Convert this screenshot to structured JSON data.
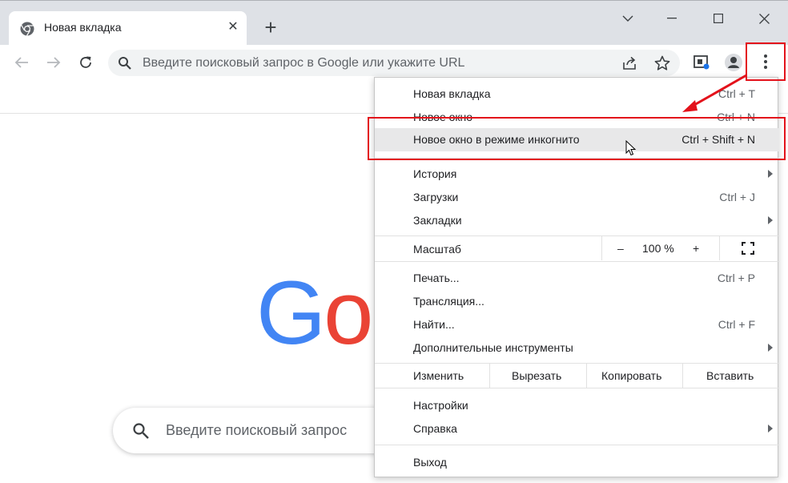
{
  "tab": {
    "title": "Новая вкладка",
    "close_glyph": "✕"
  },
  "new_tab_glyph": "+",
  "window_controls": {
    "tablist_glyph": "⌄",
    "minimize_glyph": "—",
    "maximize_glyph": "☐",
    "close_glyph": "✕"
  },
  "omnibox": {
    "placeholder": "Введите поисковый запрос в Google или укажите URL"
  },
  "page": {
    "logo_letters": [
      "G",
      "o"
    ],
    "search_placeholder": "Введите поисковый запрос"
  },
  "menu": {
    "new_tab": {
      "label": "Новая вкладка",
      "shortcut": "Ctrl + T"
    },
    "new_window": {
      "label": "Новое окно",
      "shortcut": "Ctrl + N"
    },
    "incognito": {
      "label": "Новое окно в режиме инкогнито",
      "shortcut": "Ctrl + Shift + N"
    },
    "history": {
      "label": "История"
    },
    "downloads": {
      "label": "Загрузки",
      "shortcut": "Ctrl + J"
    },
    "bookmarks": {
      "label": "Закладки"
    },
    "zoom": {
      "label": "Масштаб",
      "minus": "–",
      "value": "100 %",
      "plus": "+"
    },
    "print": {
      "label": "Печать...",
      "shortcut": "Ctrl + P"
    },
    "cast": {
      "label": "Трансляция..."
    },
    "find": {
      "label": "Найти...",
      "shortcut": "Ctrl + F"
    },
    "more_tools": {
      "label": "Дополнительные инструменты"
    },
    "edit": {
      "label": "Изменить",
      "cut": "Вырезать",
      "copy": "Копировать",
      "paste": "Вставить"
    },
    "settings": {
      "label": "Настройки"
    },
    "help": {
      "label": "Справка"
    },
    "exit": {
      "label": "Выход"
    }
  },
  "colors": {
    "annotation_red": "#e3121b",
    "google_blue": "#4285f4",
    "google_red": "#ea4335",
    "menu_highlight": "#e8e8e9"
  }
}
